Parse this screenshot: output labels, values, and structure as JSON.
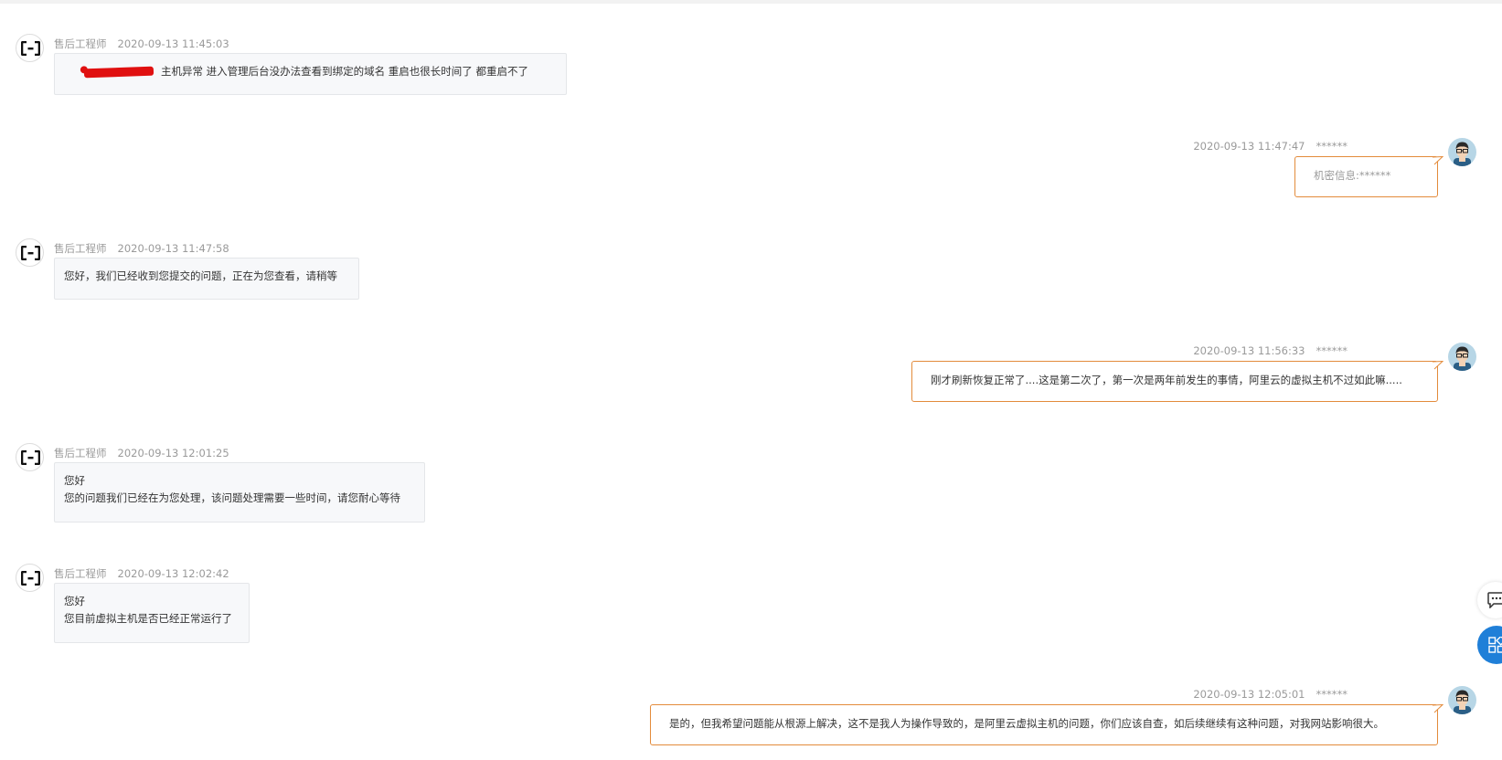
{
  "messages": [
    {
      "side": "left",
      "sender": "售后工程师",
      "time": "2020-09-13 11:45:03",
      "text": "主机异常   进入管理后台没办法查看到绑定的域名  重启也很长时间了 都重启不了"
    },
    {
      "side": "right",
      "time": "2020-09-13 11:47:47",
      "user": "******",
      "text": "机密信息:******"
    },
    {
      "side": "left",
      "sender": "售后工程师",
      "time": "2020-09-13 11:47:58",
      "text": "您好，我们已经收到您提交的问题，正在为您查看，请稍等"
    },
    {
      "side": "right",
      "time": "2020-09-13 11:56:33",
      "user": "******",
      "text": "刚才刷新恢复正常了....这是第二次了，第一次是两年前发生的事情，阿里云的虚拟主机不过如此嘛....."
    },
    {
      "side": "left",
      "sender": "售后工程师",
      "time": "2020-09-13 12:01:25",
      "line1": "您好",
      "line2": "您的问题我们已经在为您处理，该问题处理需要一些时间，请您耐心等待"
    },
    {
      "side": "left",
      "sender": "售后工程师",
      "time": "2020-09-13 12:02:42",
      "line1": "您好",
      "line2": "您目前虚拟主机是否已经正常运行了"
    },
    {
      "side": "right",
      "time": "2020-09-13 12:05:01",
      "user": "******",
      "text": "是的，但我希望问题能从根源上解决，这不是我人为操作导致的，是阿里云虚拟主机的问题，你们应该自查，如后续继续有这种问题，对我网站影响很大。"
    }
  ],
  "icons": {
    "engineer_avatar": "aliyun-logo-icon",
    "user_avatar": "cartoon-person-avatar",
    "fab_chat": "chat-bubble-icon",
    "fab_apps": "apps-grid-icon"
  },
  "colors": {
    "user_bubble_border": "#e38b3b",
    "engineer_bubble_bg": "#f7f8fa",
    "fab_blue": "#1f7fd8",
    "redaction": "#e01010"
  }
}
